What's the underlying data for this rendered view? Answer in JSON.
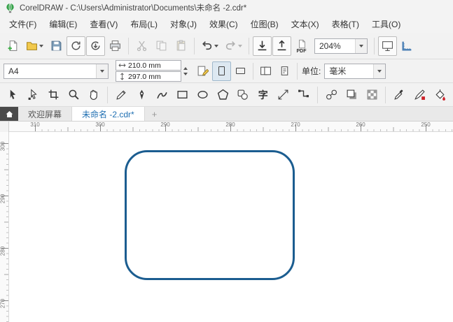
{
  "titlebar": {
    "title": "CorelDRAW - C:\\Users\\Administrator\\Documents\\未命名 -2.cdr*"
  },
  "menubar": {
    "items": [
      {
        "label": "文件(F)"
      },
      {
        "label": "编辑(E)"
      },
      {
        "label": "查看(V)"
      },
      {
        "label": "布局(L)"
      },
      {
        "label": "对象(J)"
      },
      {
        "label": "效果(C)"
      },
      {
        "label": "位图(B)"
      },
      {
        "label": "文本(X)"
      },
      {
        "label": "表格(T)"
      },
      {
        "label": "工具(O)"
      }
    ]
  },
  "toolbar": {
    "pdf_label": "PDF",
    "zoom_value": "204%"
  },
  "property_bar": {
    "page_size_value": "A4",
    "page_width": "210.0 mm",
    "page_height": "297.0 mm",
    "units_label": "单位:",
    "units_value": "毫米"
  },
  "tabbar": {
    "tabs": [
      {
        "label": "欢迎屏幕"
      },
      {
        "label": "未命名 -2.cdr*"
      }
    ],
    "new_tab_label": "+"
  },
  "toolbox": {
    "text_tool_label": "字"
  },
  "rulers": {
    "horizontal_labels": [
      "310",
      "300",
      "290",
      "280",
      "270",
      "260",
      "250"
    ],
    "vertical_labels": [
      "300",
      "290",
      "280",
      "270"
    ]
  },
  "canvas": {
    "object_type": "rounded-rectangle",
    "object_stroke_color": "#1b5d90",
    "object_fill": "none"
  },
  "colors": {
    "active_tab_text": "#1f6fb2",
    "toolbar_background": "#f2f2f2"
  }
}
